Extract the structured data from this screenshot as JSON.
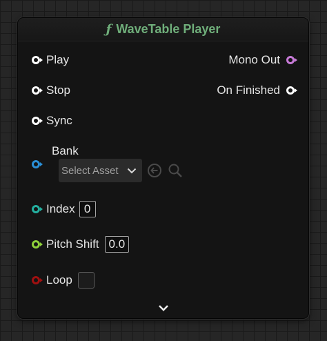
{
  "node": {
    "title": "WaveTable Player",
    "title_icon": "function-icon",
    "title_glyph": "ƒ",
    "title_color": "#6fae7a"
  },
  "inputs": {
    "play": {
      "label": "Play",
      "pin_color": "#ffffff",
      "icon": "exec-pin-icon"
    },
    "stop": {
      "label": "Stop",
      "pin_color": "#ffffff",
      "icon": "exec-pin-icon"
    },
    "sync": {
      "label": "Sync",
      "pin_color": "#ffffff",
      "icon": "exec-pin-icon"
    },
    "bank": {
      "label": "Bank",
      "pin_color": "#2a8fd6",
      "asset_placeholder": "Select Asset",
      "icons": [
        "chevron-down-icon",
        "use-selected-asset-icon",
        "browse-asset-icon"
      ]
    },
    "index": {
      "label": "Index",
      "value": "0",
      "pin_color": "#24b0a0"
    },
    "pitch_shift": {
      "label": "Pitch Shift",
      "value": "0.0",
      "pin_color": "#8ed03a"
    },
    "loop": {
      "label": "Loop",
      "value": false,
      "pin_color": "#a01010"
    }
  },
  "outputs": {
    "mono_out": {
      "label": "Mono Out",
      "pin_color": "#c87bd8",
      "icon": "audio-pin-icon"
    },
    "on_finished": {
      "label": "On Finished",
      "pin_color": "#ffffff",
      "icon": "exec-pin-icon"
    }
  },
  "footer": {
    "expand_icon": "chevron-down-icon"
  }
}
